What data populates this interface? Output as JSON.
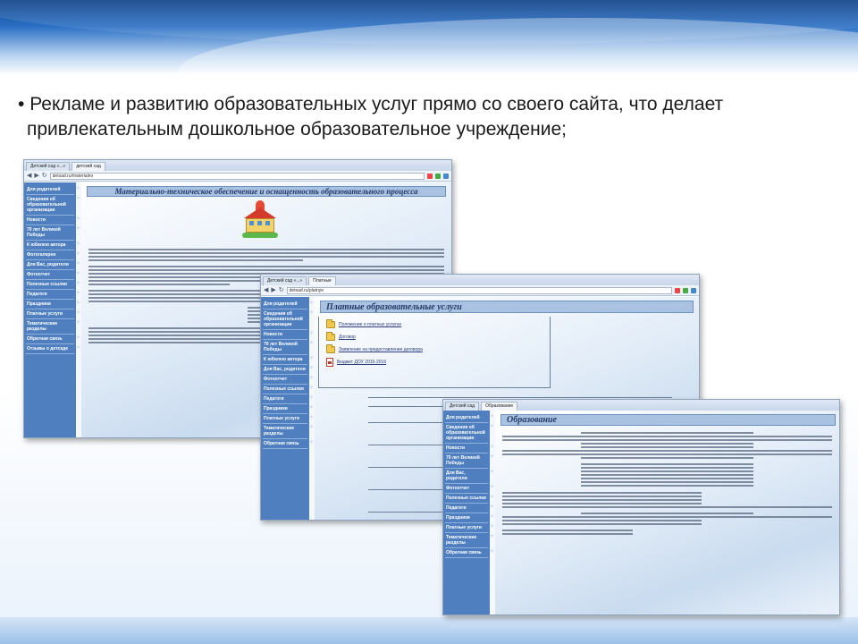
{
  "slide": {
    "bullet": "•",
    "line1": "Рекламе и развитию образовательных услуг прямо со своего сайта, что делает",
    "line2": "привлекательным дошкольное образовательное учреждение;"
  },
  "windows": [
    {
      "tabs": [
        "Детский сад «...»",
        "детский сад"
      ],
      "url": "detsad.ru/materialno",
      "title": "Материально-техническое обеспечение и оснащенность образовательного процесса",
      "sidebar": [
        "Для родителей",
        "Сведения об образовательной организации",
        "Новости",
        "70 лет Великой Победы",
        "К юбилею автора",
        "Фотогалерея",
        "Для Вас, родители",
        "Фотоотчет",
        "Полезные ссылки",
        "Педагоги",
        "Праздники",
        "Платные услуги",
        "Тематические разделы",
        "Обратная связь",
        "Отзывы о детсаде"
      ]
    },
    {
      "tabs": [
        "Детский сад «...»",
        "Платные"
      ],
      "url": "detsad.ru/platnye",
      "title": "Платные образовательные услуги",
      "folders": [
        {
          "kind": "folder",
          "label": "Положение о платных услугах"
        },
        {
          "kind": "folder",
          "label": "Договор"
        },
        {
          "kind": "folder",
          "label": "Заявление на предоставление договора"
        },
        {
          "kind": "pdf",
          "label": "Бюджет ДОУ 2015-2016"
        }
      ],
      "sidebar": [
        "Для родителей",
        "Сведения об образовательной организации",
        "Новости",
        "70 лет Великой Победы",
        "К юбилею автора",
        "Для Вас, родители",
        "Фотоотчет",
        "Полезные ссылки",
        "Педагоги",
        "Праздники",
        "Платные услуги",
        "Тематические разделы",
        "Обратная связь"
      ]
    },
    {
      "tabs": [
        "Детский сад",
        "Образование"
      ],
      "url": "detsad.ru/obrazovanie",
      "title": "Образование",
      "sidebar": [
        "Для родителей",
        "Сведения об образовательной организации",
        "Новости",
        "70 лет Великой Победы",
        "Для Вас, родители",
        "Фотоотчет",
        "Полезные ссылки",
        "Педагоги",
        "Праздники",
        "Платные услуги",
        "Тематические разделы",
        "Обратная связь"
      ]
    }
  ]
}
